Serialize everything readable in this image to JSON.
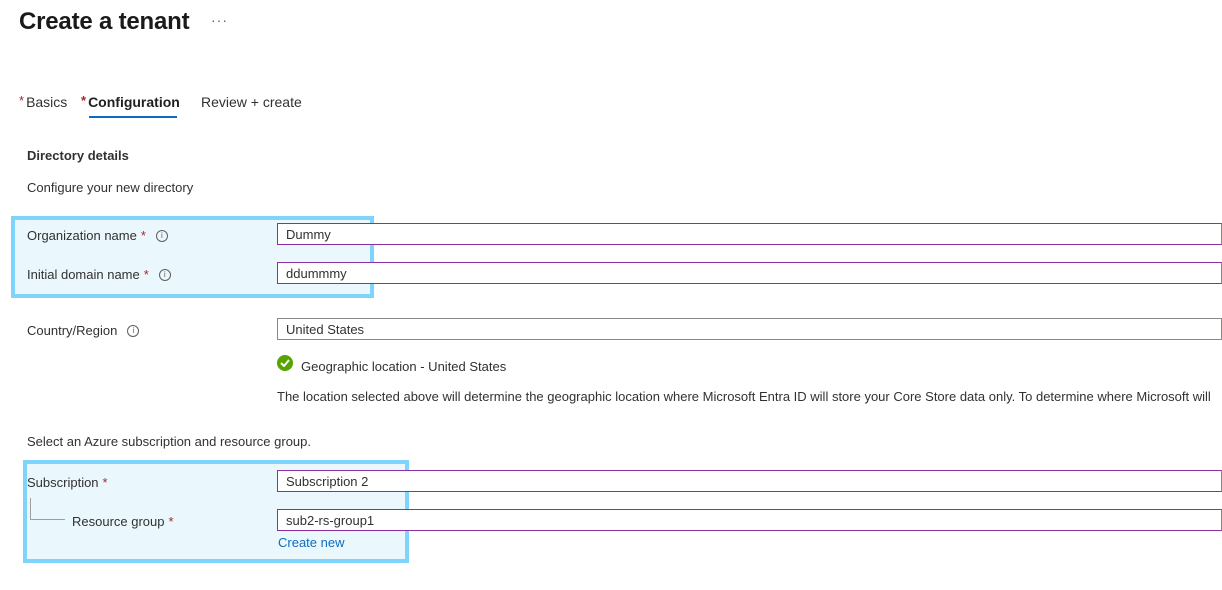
{
  "header": {
    "title": "Create a tenant",
    "more_label": "···"
  },
  "tabs": [
    {
      "label": "Basics",
      "required": "*"
    },
    {
      "label": "Configuration",
      "required": "*"
    },
    {
      "label": "Review + create",
      "required": ""
    }
  ],
  "section": {
    "title": "Directory details",
    "description": "Configure your new directory"
  },
  "fields": {
    "org_name": {
      "label": "Organization name",
      "required": "*",
      "value": "Dummy"
    },
    "domain_name": {
      "label": "Initial domain name",
      "required": "*",
      "value": "ddummmy"
    },
    "country": {
      "label": "Country/Region",
      "value": "United States"
    }
  },
  "geo": {
    "status": "Geographic location - United States",
    "note": "The location selected above will determine the geographic location where Microsoft Entra ID will store your Core Store data only. To determine where Microsoft will"
  },
  "subscription_section": {
    "description": "Select an Azure subscription and resource group.",
    "subscription": {
      "label": "Subscription",
      "required": "*",
      "value": "Subscription 2"
    },
    "resource_group": {
      "label": "Resource group",
      "required": "*",
      "value": "sub2-rs-group1"
    },
    "create_new": "Create new"
  },
  "colors": {
    "accent": "#0f6cbd",
    "highlight_border": "#7ed4fb",
    "highlight_fill": "#eaf7fd",
    "required": "#a4262c",
    "success": "#57a300"
  },
  "icons": {
    "info": "info-icon",
    "success": "check-circle-icon",
    "more": "ellipsis-icon"
  }
}
